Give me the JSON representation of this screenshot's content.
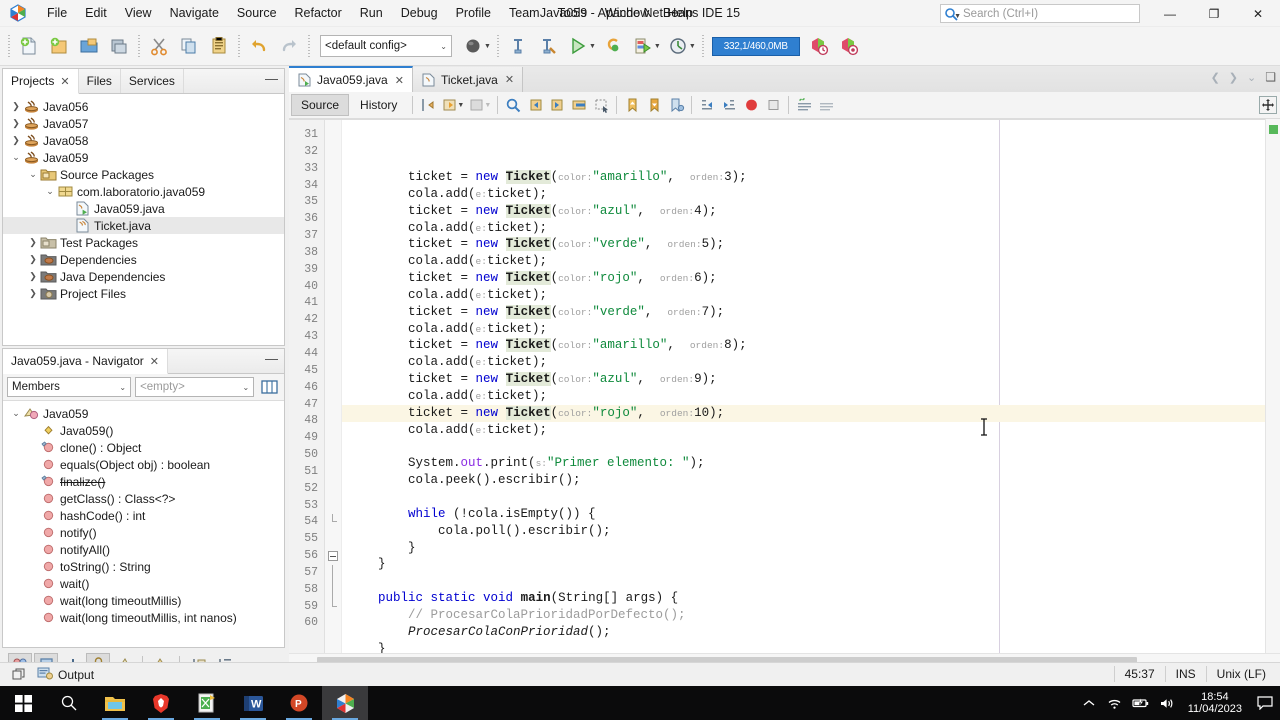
{
  "window": {
    "title": "Java059 - Apache NetBeans IDE 15",
    "minimize": "—",
    "maximize": "❐",
    "close": "✕"
  },
  "menu": {
    "items": [
      "File",
      "Edit",
      "View",
      "Navigate",
      "Source",
      "Refactor",
      "Run",
      "Debug",
      "Profile",
      "Team",
      "Tools",
      "Window",
      "Help"
    ]
  },
  "search": {
    "placeholder": "Search (Ctrl+I)",
    "value": ""
  },
  "toolbar": {
    "config_value": "<default config>",
    "memory": "332,1/460,0MB",
    "buttons": [
      "new-file",
      "new-project",
      "open-project",
      "save-all",
      "cut",
      "copy",
      "paste",
      "undo",
      "redo",
      "set-browser",
      "build-project",
      "clean-and-build",
      "run-project",
      "debug-project",
      "profile-project"
    ]
  },
  "projects_panel": {
    "tabs": [
      {
        "label": "Projects",
        "active": true,
        "closable": true
      },
      {
        "label": "Files",
        "active": false,
        "closable": false
      },
      {
        "label": "Services",
        "active": false,
        "closable": false
      }
    ],
    "tree": [
      {
        "label": "Java056",
        "depth": 0,
        "expander": "collapsed",
        "icon": "java-project-icon",
        "selected": false
      },
      {
        "label": "Java057",
        "depth": 0,
        "expander": "collapsed",
        "icon": "java-project-icon",
        "selected": false
      },
      {
        "label": "Java058",
        "depth": 0,
        "expander": "collapsed",
        "icon": "java-project-icon",
        "selected": false
      },
      {
        "label": "Java059",
        "depth": 0,
        "expander": "expanded",
        "icon": "java-project-icon",
        "selected": false
      },
      {
        "label": "Source Packages",
        "depth": 1,
        "expander": "expanded",
        "icon": "source-packages-icon",
        "selected": false
      },
      {
        "label": "com.laboratorio.java059",
        "depth": 2,
        "expander": "expanded",
        "icon": "package-icon",
        "selected": false
      },
      {
        "label": "Java059.java",
        "depth": 3,
        "expander": "none",
        "icon": "java-main-file-icon",
        "selected": false
      },
      {
        "label": "Ticket.java",
        "depth": 3,
        "expander": "none",
        "icon": "java-file-icon",
        "selected": true
      },
      {
        "label": "Test Packages",
        "depth": 1,
        "expander": "collapsed",
        "icon": "test-packages-icon",
        "selected": false
      },
      {
        "label": "Dependencies",
        "depth": 1,
        "expander": "collapsed",
        "icon": "dependencies-icon",
        "selected": false
      },
      {
        "label": "Java Dependencies",
        "depth": 1,
        "expander": "collapsed",
        "icon": "dependencies-icon",
        "selected": false
      },
      {
        "label": "Project Files",
        "depth": 1,
        "expander": "collapsed",
        "icon": "project-files-icon",
        "selected": false
      }
    ]
  },
  "navigator_panel": {
    "tab_label": "Java059.java - Navigator",
    "filter_scope": "Members",
    "filter_empty": "<empty>",
    "tree": [
      {
        "label": "Java059",
        "depth": 0,
        "expander": "expanded",
        "icon": "class-icon",
        "strike": false
      },
      {
        "label": "Java059()",
        "depth": 1,
        "expander": "none",
        "icon": "constructor-icon",
        "strike": false
      },
      {
        "label": "clone() : Object",
        "depth": 1,
        "expander": "none",
        "icon": "protected-method-icon",
        "strike": false
      },
      {
        "label": "equals(Object obj) : boolean",
        "depth": 1,
        "expander": "none",
        "icon": "public-method-icon",
        "strike": false
      },
      {
        "label": "finalize()",
        "depth": 1,
        "expander": "none",
        "icon": "protected-method-icon",
        "strike": true
      },
      {
        "label": "getClass() : Class<?>",
        "depth": 1,
        "expander": "none",
        "icon": "public-method-icon",
        "strike": false
      },
      {
        "label": "hashCode() : int",
        "depth": 1,
        "expander": "none",
        "icon": "public-method-icon",
        "strike": false
      },
      {
        "label": "notify()",
        "depth": 1,
        "expander": "none",
        "icon": "public-method-icon",
        "strike": false
      },
      {
        "label": "notifyAll()",
        "depth": 1,
        "expander": "none",
        "icon": "public-method-icon",
        "strike": false
      },
      {
        "label": "toString() : String",
        "depth": 1,
        "expander": "none",
        "icon": "public-method-icon",
        "strike": false
      },
      {
        "label": "wait()",
        "depth": 1,
        "expander": "none",
        "icon": "public-method-icon",
        "strike": false
      },
      {
        "label": "wait(long timeoutMillis)",
        "depth": 1,
        "expander": "none",
        "icon": "public-method-icon",
        "strike": false
      },
      {
        "label": "wait(long timeoutMillis, int nanos)",
        "depth": 1,
        "expander": "none",
        "icon": "public-method-icon",
        "strike": false
      }
    ]
  },
  "editor": {
    "document_tabs": [
      {
        "label": "Java059.java",
        "active": true
      },
      {
        "label": "Ticket.java",
        "active": false
      }
    ],
    "view_toggles": [
      {
        "label": "Source",
        "active": true
      },
      {
        "label": "History",
        "active": false
      }
    ],
    "first_line": 31,
    "current_line": 45,
    "lines": [
      {
        "n": 31,
        "tokens": [
          {
            "t": "        ticket = ",
            "c": ""
          },
          {
            "t": "new",
            "c": "kw"
          },
          {
            "t": " ",
            "c": ""
          },
          {
            "t": "Ticket",
            "c": "cls"
          },
          {
            "t": "(",
            "c": ""
          },
          {
            "t": "color:",
            "c": "hint"
          },
          {
            "t": "\"amarillo\"",
            "c": "str"
          },
          {
            "t": ",  ",
            "c": ""
          },
          {
            "t": "orden:",
            "c": "hint"
          },
          {
            "t": "3);",
            "c": ""
          }
        ]
      },
      {
        "n": 32,
        "tokens": [
          {
            "t": "        cola.add(",
            "c": ""
          },
          {
            "t": "e:",
            "c": "hint"
          },
          {
            "t": "ticket);",
            "c": ""
          }
        ]
      },
      {
        "n": 33,
        "tokens": [
          {
            "t": "        ticket = ",
            "c": ""
          },
          {
            "t": "new",
            "c": "kw"
          },
          {
            "t": " ",
            "c": ""
          },
          {
            "t": "Ticket",
            "c": "cls"
          },
          {
            "t": "(",
            "c": ""
          },
          {
            "t": "color:",
            "c": "hint"
          },
          {
            "t": "\"azul\"",
            "c": "str"
          },
          {
            "t": ",  ",
            "c": ""
          },
          {
            "t": "orden:",
            "c": "hint"
          },
          {
            "t": "4);",
            "c": ""
          }
        ]
      },
      {
        "n": 34,
        "tokens": [
          {
            "t": "        cola.add(",
            "c": ""
          },
          {
            "t": "e:",
            "c": "hint"
          },
          {
            "t": "ticket);",
            "c": ""
          }
        ]
      },
      {
        "n": 35,
        "tokens": [
          {
            "t": "        ticket = ",
            "c": ""
          },
          {
            "t": "new",
            "c": "kw"
          },
          {
            "t": " ",
            "c": ""
          },
          {
            "t": "Ticket",
            "c": "cls"
          },
          {
            "t": "(",
            "c": ""
          },
          {
            "t": "color:",
            "c": "hint"
          },
          {
            "t": "\"verde\"",
            "c": "str"
          },
          {
            "t": ",  ",
            "c": ""
          },
          {
            "t": "orden:",
            "c": "hint"
          },
          {
            "t": "5);",
            "c": ""
          }
        ]
      },
      {
        "n": 36,
        "tokens": [
          {
            "t": "        cola.add(",
            "c": ""
          },
          {
            "t": "e:",
            "c": "hint"
          },
          {
            "t": "ticket);",
            "c": ""
          }
        ]
      },
      {
        "n": 37,
        "tokens": [
          {
            "t": "        ticket = ",
            "c": ""
          },
          {
            "t": "new",
            "c": "kw"
          },
          {
            "t": " ",
            "c": ""
          },
          {
            "t": "Ticket",
            "c": "cls"
          },
          {
            "t": "(",
            "c": ""
          },
          {
            "t": "color:",
            "c": "hint"
          },
          {
            "t": "\"rojo\"",
            "c": "str"
          },
          {
            "t": ",  ",
            "c": ""
          },
          {
            "t": "orden:",
            "c": "hint"
          },
          {
            "t": "6);",
            "c": ""
          }
        ]
      },
      {
        "n": 38,
        "tokens": [
          {
            "t": "        cola.add(",
            "c": ""
          },
          {
            "t": "e:",
            "c": "hint"
          },
          {
            "t": "ticket);",
            "c": ""
          }
        ]
      },
      {
        "n": 39,
        "tokens": [
          {
            "t": "        ticket = ",
            "c": ""
          },
          {
            "t": "new",
            "c": "kw"
          },
          {
            "t": " ",
            "c": ""
          },
          {
            "t": "Ticket",
            "c": "cls"
          },
          {
            "t": "(",
            "c": ""
          },
          {
            "t": "color:",
            "c": "hint"
          },
          {
            "t": "\"verde\"",
            "c": "str"
          },
          {
            "t": ",  ",
            "c": ""
          },
          {
            "t": "orden:",
            "c": "hint"
          },
          {
            "t": "7);",
            "c": ""
          }
        ]
      },
      {
        "n": 40,
        "tokens": [
          {
            "t": "        cola.add(",
            "c": ""
          },
          {
            "t": "e:",
            "c": "hint"
          },
          {
            "t": "ticket);",
            "c": ""
          }
        ]
      },
      {
        "n": 41,
        "tokens": [
          {
            "t": "        ticket = ",
            "c": ""
          },
          {
            "t": "new",
            "c": "kw"
          },
          {
            "t": " ",
            "c": ""
          },
          {
            "t": "Ticket",
            "c": "cls"
          },
          {
            "t": "(",
            "c": ""
          },
          {
            "t": "color:",
            "c": "hint"
          },
          {
            "t": "\"amarillo\"",
            "c": "str"
          },
          {
            "t": ",  ",
            "c": ""
          },
          {
            "t": "orden:",
            "c": "hint"
          },
          {
            "t": "8);",
            "c": ""
          }
        ]
      },
      {
        "n": 42,
        "tokens": [
          {
            "t": "        cola.add(",
            "c": ""
          },
          {
            "t": "e:",
            "c": "hint"
          },
          {
            "t": "ticket);",
            "c": ""
          }
        ]
      },
      {
        "n": 43,
        "tokens": [
          {
            "t": "        ticket = ",
            "c": ""
          },
          {
            "t": "new",
            "c": "kw"
          },
          {
            "t": " ",
            "c": ""
          },
          {
            "t": "Ticket",
            "c": "cls"
          },
          {
            "t": "(",
            "c": ""
          },
          {
            "t": "color:",
            "c": "hint"
          },
          {
            "t": "\"azul\"",
            "c": "str"
          },
          {
            "t": ",  ",
            "c": ""
          },
          {
            "t": "orden:",
            "c": "hint"
          },
          {
            "t": "9);",
            "c": ""
          }
        ]
      },
      {
        "n": 44,
        "tokens": [
          {
            "t": "        cola.add(",
            "c": ""
          },
          {
            "t": "e:",
            "c": "hint"
          },
          {
            "t": "ticket);",
            "c": ""
          }
        ]
      },
      {
        "n": 45,
        "tokens": [
          {
            "t": "        ticket = ",
            "c": ""
          },
          {
            "t": "new",
            "c": "kw"
          },
          {
            "t": " ",
            "c": ""
          },
          {
            "t": "Ticket",
            "c": "cls"
          },
          {
            "t": "(",
            "c": ""
          },
          {
            "t": "color:",
            "c": "hint"
          },
          {
            "t": "\"rojo\"",
            "c": "str"
          },
          {
            "t": ",  ",
            "c": ""
          },
          {
            "t": "orden:",
            "c": "hint"
          },
          {
            "t": "10);",
            "c": ""
          }
        ]
      },
      {
        "n": 46,
        "tokens": [
          {
            "t": "        cola.add(",
            "c": ""
          },
          {
            "t": "e:",
            "c": "hint"
          },
          {
            "t": "ticket);",
            "c": ""
          }
        ]
      },
      {
        "n": 47,
        "tokens": []
      },
      {
        "n": 48,
        "tokens": [
          {
            "t": "        System.",
            "c": ""
          },
          {
            "t": "out",
            "c": "fld"
          },
          {
            "t": ".print(",
            "c": ""
          },
          {
            "t": "s:",
            "c": "hint"
          },
          {
            "t": "\"Primer elemento: \"",
            "c": "str"
          },
          {
            "t": ");",
            "c": ""
          }
        ]
      },
      {
        "n": 49,
        "tokens": [
          {
            "t": "        cola.peek().escribir();",
            "c": ""
          }
        ]
      },
      {
        "n": 50,
        "tokens": []
      },
      {
        "n": 51,
        "tokens": [
          {
            "t": "        ",
            "c": ""
          },
          {
            "t": "while",
            "c": "kw"
          },
          {
            "t": " (!cola.isEmpty()) {",
            "c": ""
          }
        ]
      },
      {
        "n": 52,
        "tokens": [
          {
            "t": "            cola.poll().escribir();",
            "c": ""
          }
        ]
      },
      {
        "n": 53,
        "tokens": [
          {
            "t": "        }",
            "c": ""
          }
        ]
      },
      {
        "n": 54,
        "tokens": [
          {
            "t": "    }",
            "c": ""
          }
        ]
      },
      {
        "n": 55,
        "tokens": []
      },
      {
        "n": 56,
        "tokens": [
          {
            "t": "    ",
            "c": ""
          },
          {
            "t": "public static void",
            "c": "kw"
          },
          {
            "t": " ",
            "c": ""
          },
          {
            "t": "main",
            "c": "bld"
          },
          {
            "t": "(String[] args) {",
            "c": ""
          }
        ]
      },
      {
        "n": 57,
        "tokens": [
          {
            "t": "        // ProcesarColaPrioridadPorDefecto();",
            "c": "cmt"
          }
        ]
      },
      {
        "n": 58,
        "tokens": [
          {
            "t": "        ",
            "c": ""
          },
          {
            "t": "ProcesarColaConPrioridad",
            "c": "ital"
          },
          {
            "t": "();",
            "c": ""
          }
        ]
      },
      {
        "n": 59,
        "tokens": [
          {
            "t": "    }",
            "c": ""
          }
        ]
      },
      {
        "n": 60,
        "tokens": [
          {
            "t": "}",
            "c": ""
          }
        ]
      }
    ]
  },
  "output_bar": {
    "label": "Output"
  },
  "status_bar": {
    "position": "45:37",
    "insert_mode": "INS",
    "line_ending": "Unix (LF)"
  },
  "taskbar": {
    "items": [
      {
        "name": "start-button",
        "icon": "windows-logo-icon"
      },
      {
        "name": "search-taskbar",
        "icon": "search-icon"
      },
      {
        "name": "file-explorer",
        "icon": "folder-icon"
      },
      {
        "name": "brave-browser",
        "icon": "brave-lion-icon"
      },
      {
        "name": "excel-app",
        "icon": "excel-icon"
      },
      {
        "name": "word-app",
        "icon": "word-icon"
      },
      {
        "name": "powerpoint-app",
        "icon": "powerpoint-icon"
      },
      {
        "name": "netbeans-app",
        "icon": "netbeans-cube-icon"
      }
    ],
    "tray": {
      "time": "18:54",
      "date": "11/04/2023"
    }
  },
  "colors": {
    "accent": "#2f7fd0",
    "string": "#0f8a3c",
    "keyword": "#0000d0",
    "hint": "#a0a0a0",
    "current_line": "#fbf6e4",
    "class_highlight": "#e3ead9"
  }
}
